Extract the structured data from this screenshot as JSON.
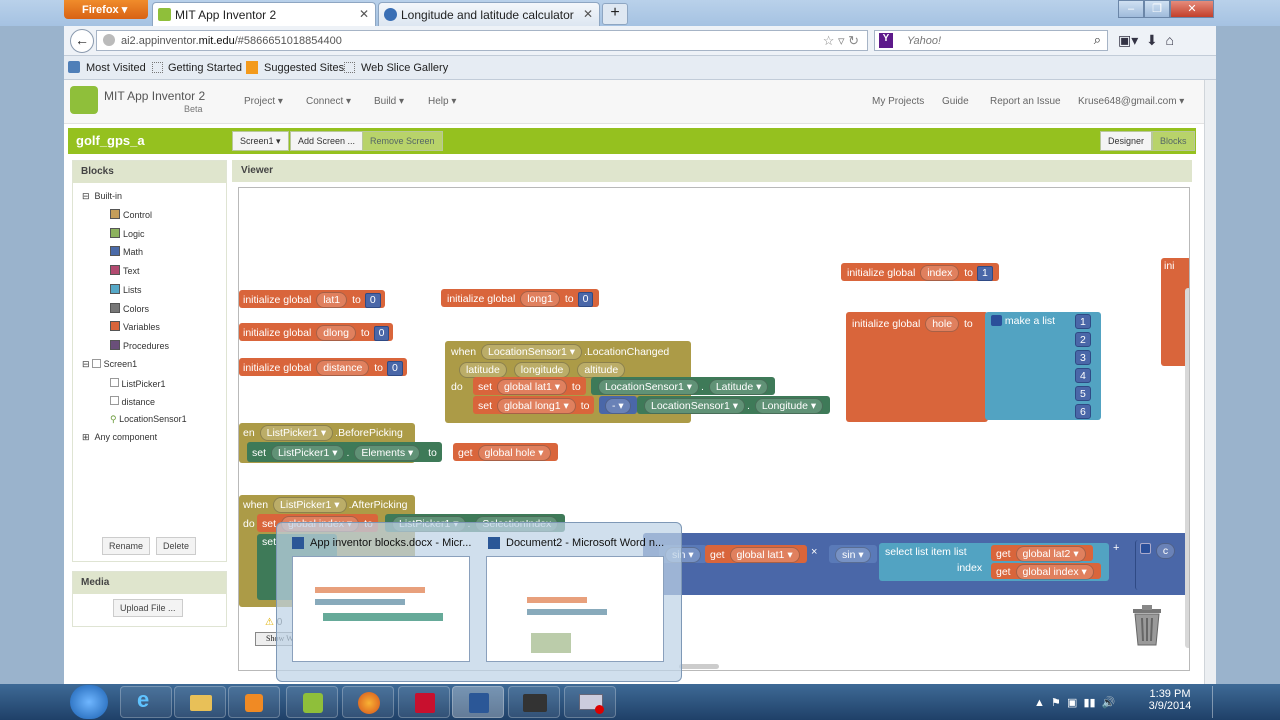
{
  "browser": {
    "firefox_label": "Firefox",
    "tabs": [
      {
        "title": "MIT App Inventor 2"
      },
      {
        "title": "Longitude and latitude calculator"
      }
    ],
    "url_prefix": "ai2.appinventor.",
    "url_domain": "mit.edu",
    "url_suffix": "/#5866651018854400",
    "search_placeholder": "Yahoo!",
    "bookmarks": [
      "Most Visited",
      "Getting Started",
      "Suggested Sites",
      "Web Slice Gallery"
    ]
  },
  "app": {
    "name": "MIT App Inventor 2",
    "beta": "Beta",
    "menus": [
      "Project ▾",
      "Connect ▾",
      "Build ▾",
      "Help ▾"
    ],
    "right_menus": [
      "My Projects",
      "Guide",
      "Report an Issue",
      "Kruse648@gmail.com ▾"
    ],
    "project": "golf_gps_a",
    "screen_btn": "Screen1 ▾",
    "add_screen": "Add Screen ...",
    "remove_screen": "Remove Screen",
    "designer": "Designer",
    "blocks": "Blocks"
  },
  "blocks_panel": {
    "title": "Blocks",
    "builtin": "Built-in",
    "items": [
      {
        "label": "Control",
        "color": "#c49e5a"
      },
      {
        "label": "Logic",
        "color": "#8db25e"
      },
      {
        "label": "Math",
        "color": "#4a6aa8"
      },
      {
        "label": "Text",
        "color": "#b24a70"
      },
      {
        "label": "Lists",
        "color": "#56a8c7"
      },
      {
        "label": "Colors",
        "color": "#777777"
      },
      {
        "label": "Variables",
        "color": "#d9653b"
      },
      {
        "label": "Procedures",
        "color": "#6a4f7a"
      }
    ],
    "screen": "Screen1",
    "children": [
      "ListPicker1",
      "distance",
      "LocationSensor1"
    ],
    "any_component": "Any component",
    "rename": "Rename",
    "delete": "Delete"
  },
  "media": {
    "title": "Media",
    "upload": "Upload File ..."
  },
  "viewer": {
    "title": "Viewer"
  },
  "blocks": {
    "init": "initialize global",
    "to": "to",
    "lat1": "lat1",
    "dlong": "dlong",
    "distance": "distance",
    "long1": "long1",
    "index": "index",
    "hole": "hole",
    "zero": "0",
    "one": "1",
    "make_list": "make a list",
    "list_items": [
      "1",
      "2",
      "3",
      "4",
      "5",
      "6"
    ],
    "when": "when",
    "sensor": "LocationSensor1 ▾",
    "location_changed": ".LocationChanged",
    "params": [
      "latitude",
      "longitude",
      "altitude"
    ],
    "do": "do",
    "set": "set",
    "global_lat1": "global lat1 ▾",
    "global_long1": "global long1 ▾",
    "latitude_prop": "Latitude ▾",
    "longitude_prop": "Longitude ▾",
    "minus": "- ▾",
    "en": "en",
    "listpicker": "ListPicker1 ▾",
    "before_picking": ".BeforePicking",
    "elements": "Elements ▾",
    "get": "get",
    "global_hole": "global hole ▾",
    "after_picking": ".AfterPicking",
    "global_index": "global index ▾",
    "selection_index": "SelectionIndex",
    "sin": "sin ▾",
    "times": "×",
    "select_list_item": "select list item  list",
    "index_label": "index",
    "global_lat2": "global lat2 ▾",
    "get_global_index": "global index ▾",
    "plus": "+",
    "ini": "ini",
    "warn_count": "0",
    "show_warnings": "Show Warnings",
    "c": "c"
  },
  "taskbar": {
    "switch_titles": [
      "App inventor blocks.docx - Micr...",
      "Document2 - Microsoft Word n..."
    ],
    "time": "1:39 PM",
    "date": "3/9/2014"
  }
}
